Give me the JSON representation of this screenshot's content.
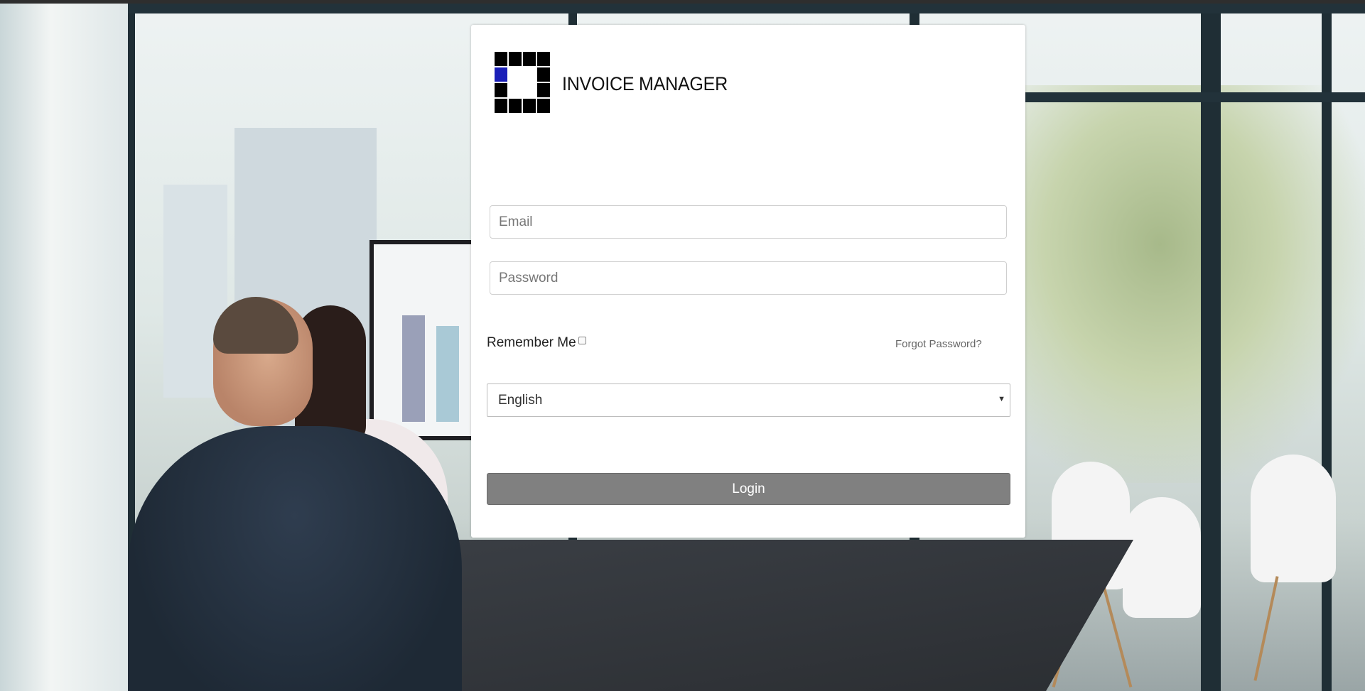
{
  "app": {
    "name": "INVOICE MANAGER",
    "logo_icon": "grid-square-logo-icon",
    "logo_accent_color": "#1a1fb8"
  },
  "form": {
    "email_placeholder": "Email",
    "email_value": "",
    "password_placeholder": "Password",
    "password_value": "",
    "remember_label": "Remember Me",
    "remember_checked": false,
    "forgot_label": "Forgot Password?",
    "language_selected": "English",
    "login_label": "Login"
  },
  "colors": {
    "login_button": "#808080",
    "card_background": "#ffffff"
  }
}
